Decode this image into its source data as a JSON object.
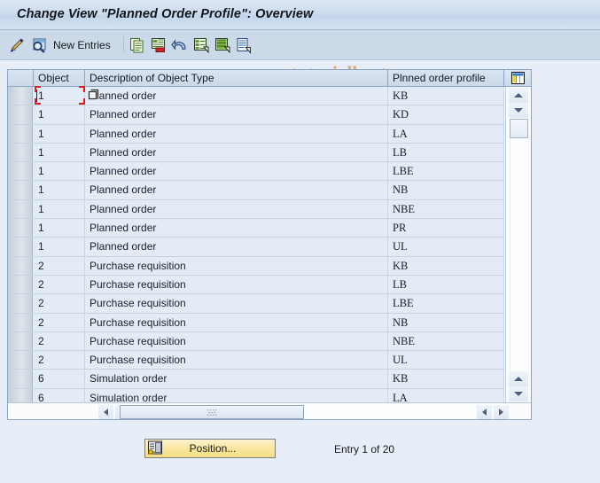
{
  "window": {
    "title": "Change View \"Planned Order Profile\": Overview"
  },
  "watermark": "www.tutorialkart.com",
  "toolbar": {
    "new_entries_label": "New Entries",
    "buttons": [
      {
        "name": "display-change-icon",
        "tooltip": "Display/Change"
      },
      {
        "name": "check-entries-icon",
        "tooltip": "Check Entries"
      },
      {
        "name": "copy-icon",
        "tooltip": "Copy As..."
      },
      {
        "name": "delete-icon",
        "tooltip": "Delete"
      },
      {
        "name": "undo-icon",
        "tooltip": "Undo Change"
      },
      {
        "name": "select-all-icon",
        "tooltip": "Select All"
      },
      {
        "name": "deselect-all-icon",
        "tooltip": "Deselect All"
      },
      {
        "name": "variant-icon",
        "tooltip": "Select Layout"
      }
    ]
  },
  "table": {
    "columns": [
      {
        "key": "select",
        "label": ""
      },
      {
        "key": "object",
        "label": "Object"
      },
      {
        "key": "description",
        "label": "Description of Object Type"
      },
      {
        "key": "profile",
        "label": "Plnned order profile"
      }
    ],
    "config_icon": "table-settings-icon",
    "rows": [
      {
        "object": "1",
        "description": "Planned order",
        "profile": "KB"
      },
      {
        "object": "1",
        "description": "Planned order",
        "profile": "KD"
      },
      {
        "object": "1",
        "description": "Planned order",
        "profile": "LA"
      },
      {
        "object": "1",
        "description": "Planned order",
        "profile": "LB"
      },
      {
        "object": "1",
        "description": "Planned order",
        "profile": "LBE"
      },
      {
        "object": "1",
        "description": "Planned order",
        "profile": "NB"
      },
      {
        "object": "1",
        "description": "Planned order",
        "profile": "NBE"
      },
      {
        "object": "1",
        "description": "Planned order",
        "profile": "PR"
      },
      {
        "object": "1",
        "description": "Planned order",
        "profile": "UL"
      },
      {
        "object": "2",
        "description": "Purchase requisition",
        "profile": "KB"
      },
      {
        "object": "2",
        "description": "Purchase requisition",
        "profile": "LB"
      },
      {
        "object": "2",
        "description": "Purchase requisition",
        "profile": "LBE"
      },
      {
        "object": "2",
        "description": "Purchase requisition",
        "profile": "NB"
      },
      {
        "object": "2",
        "description": "Purchase requisition",
        "profile": "NBE"
      },
      {
        "object": "2",
        "description": "Purchase requisition",
        "profile": "UL"
      },
      {
        "object": "6",
        "description": "Simulation order",
        "profile": "KB"
      },
      {
        "object": "6",
        "description": "Simulation order",
        "profile": "LA"
      }
    ],
    "focused_cell": {
      "row": 0,
      "column": "object"
    }
  },
  "scrollbars": {
    "vertical": {
      "up_icon": "triangle-up-icon",
      "down_icon": "triangle-down-icon"
    },
    "horizontal": {
      "left_icon": "triangle-left-icon",
      "right_icon": "triangle-right-icon"
    }
  },
  "footer": {
    "position_button_label": "Position...",
    "position_button_icon": "position-icon",
    "entry_status": "Entry 1 of 20"
  },
  "colors": {
    "title_bar": "#cddcef",
    "toolbar": "#ccd9e8",
    "page_background": "#e8eef7",
    "row_background": "#e3ecf6",
    "focus_marker": "#e21b1b",
    "button_accent": "#f8e69e",
    "watermark": "#e5ab70"
  }
}
